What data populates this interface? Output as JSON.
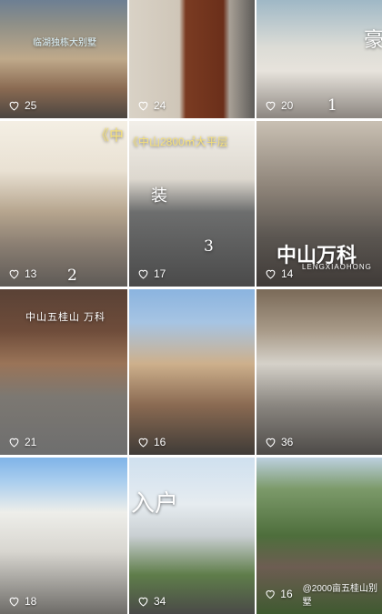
{
  "icons": {
    "like": "heart-outline-icon"
  },
  "tiles": [
    {
      "likes": "25",
      "caption": "临湖独栋大别墅"
    },
    {
      "likes": "24"
    },
    {
      "likes": "20",
      "number": "1",
      "side_text": "豪"
    },
    {
      "likes": "13",
      "number": "2",
      "title_fragment": "《中"
    },
    {
      "likes": "17",
      "number": "3",
      "title_fragment": "《中山2800㎡大平层",
      "side_text": "装"
    },
    {
      "likes": "14",
      "brand": "中山万科",
      "brand_sub": "LENGXIAOHONG"
    },
    {
      "likes": "21",
      "caption": "中山五桂山 万科"
    },
    {
      "likes": "16"
    },
    {
      "likes": "36"
    },
    {
      "likes": "18"
    },
    {
      "likes": "34",
      "side_text": "入户"
    },
    {
      "likes": "16",
      "footer_text": "@2000亩五桂山别墅"
    }
  ]
}
